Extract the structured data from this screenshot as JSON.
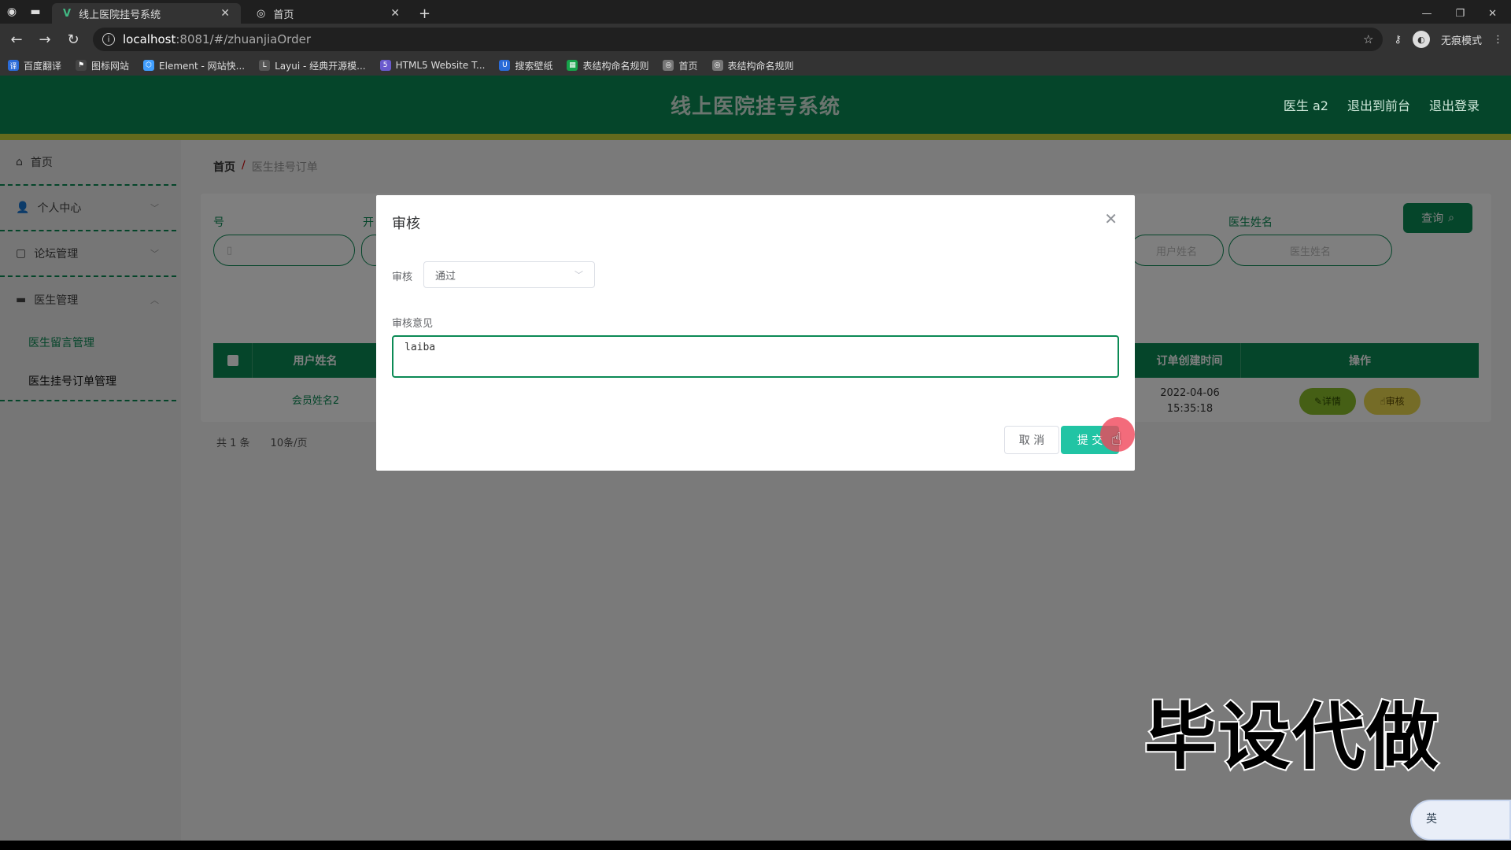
{
  "browser": {
    "tabs": [
      {
        "title": "线上医院挂号系统",
        "active": true
      },
      {
        "title": "首页",
        "active": false
      }
    ],
    "url_host": "localhost",
    "url_path": ":8081/#/zhuanjiaOrder",
    "incognito_label": "无痕模式",
    "bookmarks": [
      {
        "label": "百度翻译",
        "color": "#2a6bd8"
      },
      {
        "label": "图标网站",
        "color": "#444444"
      },
      {
        "label": "Element - 网站快...",
        "color": "#409eff"
      },
      {
        "label": "Layui - 经典开源模...",
        "color": "#555555"
      },
      {
        "label": "HTML5 Website T...",
        "color": "#6a5acd"
      },
      {
        "label": "搜索壁纸",
        "color": "#2a6bd8"
      },
      {
        "label": "表结构命名规则",
        "color": "#16a34a"
      },
      {
        "label": "首页",
        "color": "#777777"
      },
      {
        "label": "表结构命名规则",
        "color": "#777777"
      }
    ]
  },
  "header": {
    "title": "线上医院挂号系统",
    "links": [
      "医生 a2",
      "退出到前台",
      "退出登录"
    ]
  },
  "sidebar": {
    "items": [
      {
        "label": "首页",
        "icon": "home-icon"
      },
      {
        "label": "个人中心",
        "icon": "user-icon"
      },
      {
        "label": "论坛管理",
        "icon": "forum-icon"
      },
      {
        "label": "医生管理",
        "icon": "doctor-icon"
      }
    ],
    "sub_items": [
      "医生留言管理",
      "医生挂号订单管理"
    ]
  },
  "breadcrumb": {
    "home": "首页",
    "separator": "/",
    "current": "医生挂号订单"
  },
  "filters": {
    "label_1": "号",
    "label_2": "开",
    "label_doctor": "医生姓名",
    "placeholder_user": "用户姓名",
    "placeholder_doctor": "医生姓名",
    "query_label": "查询"
  },
  "table": {
    "columns": [
      "用户姓名",
      "订单创建时间",
      "操作"
    ],
    "row": {
      "user_name": "会员姓名2",
      "created_at": "2022-04-06 15:35:18"
    },
    "detail_label": "详情",
    "audit_label": "审核"
  },
  "pager": {
    "total": "共 1 条",
    "per_page": "10条/页"
  },
  "dialog": {
    "title": "审核",
    "audit_label": "审核",
    "audit_value": "通过",
    "opinion_label": "审核意见",
    "opinion_value": "laiba",
    "cancel_label": "取 消",
    "submit_label": "提 交"
  },
  "watermark": "毕设代做",
  "ime_label": "英",
  "colors": {
    "primary": "#0b8a55",
    "accent": "#c9d43a",
    "submit": "#21c4a4"
  }
}
